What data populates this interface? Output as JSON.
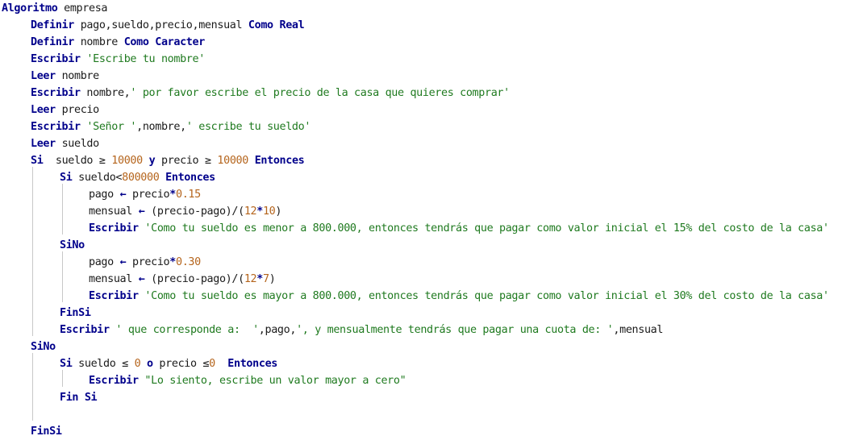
{
  "colors": {
    "keyword": "#00008b",
    "string": "#1f7a1f",
    "number": "#b5651d",
    "text": "#1a1a1a",
    "guide": "#c8c8c8",
    "background": "#ffffff"
  },
  "code": [
    {
      "indent": 0,
      "tokens": [
        [
          "kw",
          "Algoritmo"
        ],
        [
          "tx",
          " empresa"
        ]
      ]
    },
    {
      "indent": 1,
      "tokens": [
        [
          "kw",
          "Definir"
        ],
        [
          "tx",
          " pago,sueldo,precio,mensual "
        ],
        [
          "kw",
          "Como Real"
        ]
      ]
    },
    {
      "indent": 1,
      "tokens": [
        [
          "kw",
          "Definir"
        ],
        [
          "tx",
          " nombre "
        ],
        [
          "kw",
          "Como Caracter"
        ]
      ]
    },
    {
      "indent": 1,
      "tokens": [
        [
          "kw",
          "Escribir"
        ],
        [
          "tx",
          " "
        ],
        [
          "str",
          "'Escribe tu nombre'"
        ]
      ]
    },
    {
      "indent": 1,
      "tokens": [
        [
          "kw",
          "Leer"
        ],
        [
          "tx",
          " nombre"
        ]
      ]
    },
    {
      "indent": 1,
      "tokens": [
        [
          "kw",
          "Escribir"
        ],
        [
          "tx",
          " nombre,"
        ],
        [
          "str",
          "' por favor escribe el precio de la casa que quieres comprar'"
        ]
      ]
    },
    {
      "indent": 1,
      "tokens": [
        [
          "kw",
          "Leer"
        ],
        [
          "tx",
          " precio"
        ]
      ]
    },
    {
      "indent": 1,
      "tokens": [
        [
          "kw",
          "Escribir"
        ],
        [
          "tx",
          " "
        ],
        [
          "str",
          "'Señor '"
        ],
        [
          "tx",
          ",nombre,"
        ],
        [
          "str",
          "' escribe tu sueldo'"
        ]
      ]
    },
    {
      "indent": 1,
      "tokens": [
        [
          "kw",
          "Leer"
        ],
        [
          "tx",
          " sueldo"
        ]
      ]
    },
    {
      "indent": 1,
      "tokens": [
        [
          "kw",
          "Si"
        ],
        [
          "tx",
          "  sueldo ≥ "
        ],
        [
          "num",
          "10000"
        ],
        [
          "tx",
          " "
        ],
        [
          "kw",
          "y"
        ],
        [
          "tx",
          " precio ≥ "
        ],
        [
          "num",
          "10000"
        ],
        [
          "tx",
          " "
        ],
        [
          "kw",
          "Entonces"
        ]
      ]
    },
    {
      "indent": 2,
      "tokens": [
        [
          "kw",
          "Si"
        ],
        [
          "tx",
          " sueldo<"
        ],
        [
          "num",
          "800000"
        ],
        [
          "tx",
          " "
        ],
        [
          "kw",
          "Entonces"
        ]
      ]
    },
    {
      "indent": 3,
      "tokens": [
        [
          "tx",
          "pago "
        ],
        [
          "op",
          "←"
        ],
        [
          "tx",
          " precio"
        ],
        [
          "op",
          "*"
        ],
        [
          "num",
          "0.15"
        ]
      ]
    },
    {
      "indent": 3,
      "tokens": [
        [
          "tx",
          "mensual "
        ],
        [
          "op",
          "←"
        ],
        [
          "tx",
          " (precio-pago)/("
        ],
        [
          "num",
          "12"
        ],
        [
          "op",
          "*"
        ],
        [
          "num",
          "10"
        ],
        [
          "tx",
          ")"
        ]
      ]
    },
    {
      "indent": 3,
      "tokens": [
        [
          "kw",
          "Escribir"
        ],
        [
          "tx",
          " "
        ],
        [
          "str",
          "'Como tu sueldo es menor a 800.000, entonces tendrás que pagar como valor inicial el 15% del costo de la casa'"
        ]
      ]
    },
    {
      "indent": 2,
      "tokens": [
        [
          "kw",
          "SiNo"
        ]
      ]
    },
    {
      "indent": 3,
      "tokens": [
        [
          "tx",
          "pago "
        ],
        [
          "op",
          "←"
        ],
        [
          "tx",
          " precio"
        ],
        [
          "op",
          "*"
        ],
        [
          "num",
          "0.30"
        ]
      ]
    },
    {
      "indent": 3,
      "tokens": [
        [
          "tx",
          "mensual "
        ],
        [
          "op",
          "←"
        ],
        [
          "tx",
          " (precio-pago)/("
        ],
        [
          "num",
          "12"
        ],
        [
          "op",
          "*"
        ],
        [
          "num",
          "7"
        ],
        [
          "tx",
          ")"
        ]
      ]
    },
    {
      "indent": 3,
      "tokens": [
        [
          "kw",
          "Escribir"
        ],
        [
          "tx",
          " "
        ],
        [
          "str",
          "'Como tu sueldo es mayor a 800.000, entonces tendrás que pagar como valor inicial el 30% del costo de la casa'"
        ]
      ]
    },
    {
      "indent": 2,
      "tokens": [
        [
          "kw",
          "FinSi"
        ]
      ]
    },
    {
      "indent": 2,
      "tokens": [
        [
          "kw",
          "Escribir"
        ],
        [
          "tx",
          " "
        ],
        [
          "str",
          "' que corresponde a:  '"
        ],
        [
          "tx",
          ",pago,"
        ],
        [
          "str",
          "', y mensualmente tendrás que pagar una cuota de: '"
        ],
        [
          "tx",
          ",mensual"
        ]
      ]
    },
    {
      "indent": 1,
      "tokens": [
        [
          "kw",
          "SiNo"
        ]
      ]
    },
    {
      "indent": 2,
      "tokens": [
        [
          "kw",
          "Si"
        ],
        [
          "tx",
          " sueldo ≤ "
        ],
        [
          "num",
          "0"
        ],
        [
          "tx",
          " "
        ],
        [
          "kw",
          "o"
        ],
        [
          "tx",
          " precio ≤"
        ],
        [
          "num",
          "0"
        ],
        [
          "tx",
          "  "
        ],
        [
          "kw",
          "Entonces"
        ]
      ]
    },
    {
      "indent": 3,
      "tokens": [
        [
          "kw",
          "Escribir"
        ],
        [
          "tx",
          " "
        ],
        [
          "str",
          "\"Lo siento, escribe un valor mayor a cero\""
        ]
      ]
    },
    {
      "indent": 2,
      "tokens": [
        [
          "kw",
          "Fin Si"
        ]
      ]
    },
    {
      "indent": 2,
      "tokens": []
    },
    {
      "indent": 1,
      "tokens": [
        [
          "kw",
          "FinSi"
        ]
      ]
    }
  ]
}
